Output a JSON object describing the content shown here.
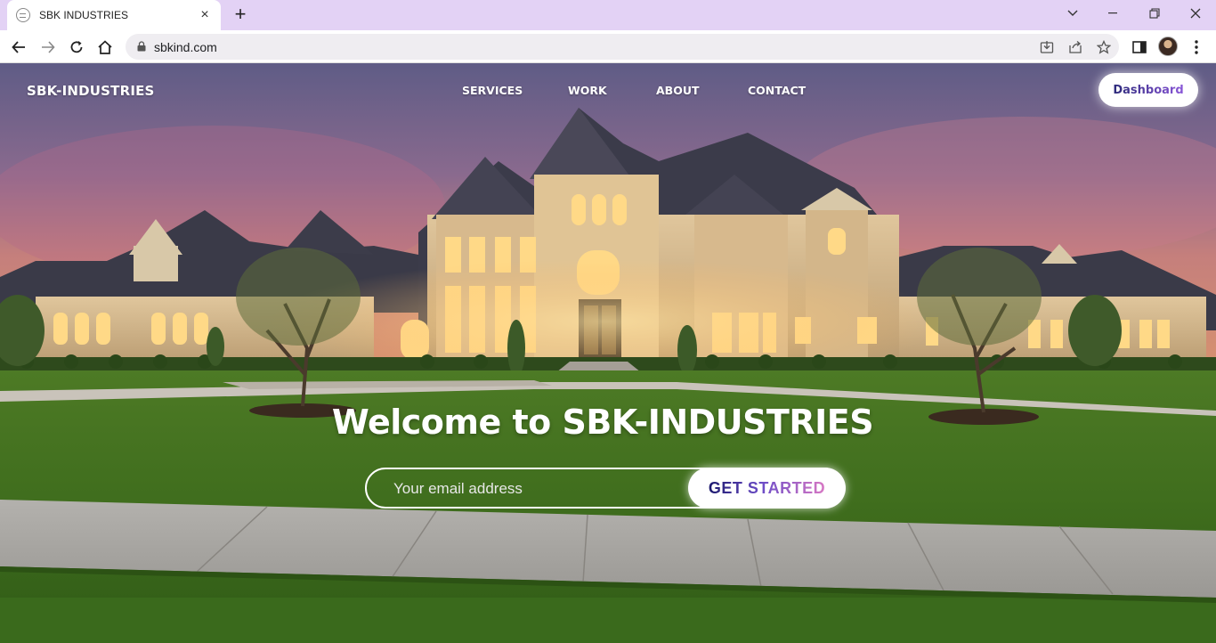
{
  "browser": {
    "tab_title": "SBK INDUSTRIES",
    "new_tab_label": "+",
    "url": "sbkind.com"
  },
  "site": {
    "brand": "SBK-INDUSTRIES",
    "nav": [
      "SERVICES",
      "WORK",
      "ABOUT",
      "CONTACT"
    ],
    "dashboard_label": "Dashboard"
  },
  "hero": {
    "title": "Welcome to SBK-INDUSTRIES",
    "email_placeholder": "Your email address",
    "cta_label": "GET STARTED"
  },
  "colors": {
    "tab_strip": "#e3d2f5",
    "button_gradient_start": "#1c1a6e",
    "button_gradient_end": "#d878c4"
  },
  "icons": [
    "back-arrow-icon",
    "forward-arrow-icon",
    "reload-icon",
    "home-icon",
    "lock-icon",
    "install-icon",
    "share-icon",
    "bookmark-star-icon",
    "side-panel-icon",
    "more-vert-icon",
    "minimize-icon",
    "restore-icon",
    "close-icon",
    "tab-search-icon"
  ]
}
